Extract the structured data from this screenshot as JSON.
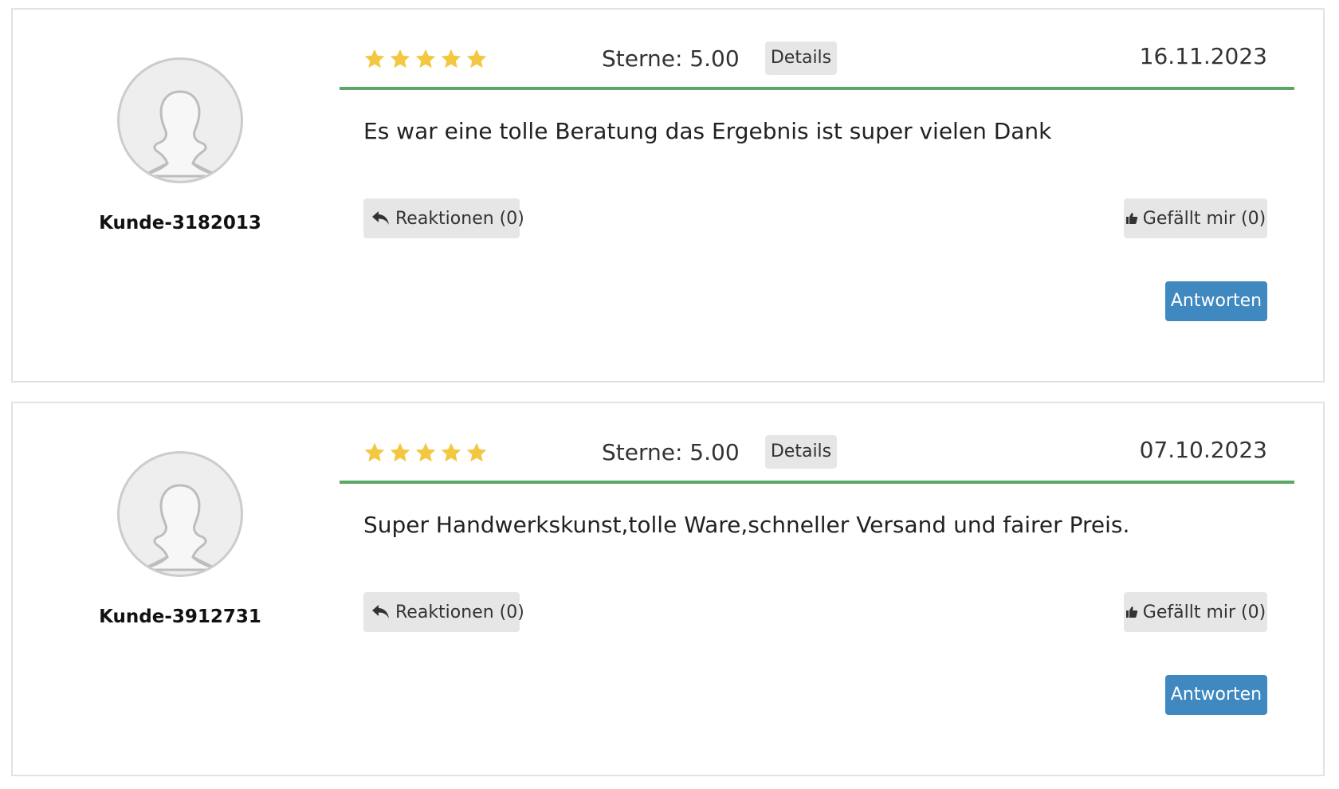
{
  "reviews": [
    {
      "username": "Kunde-3182013",
      "score_text": "Sterne: 5.00",
      "stars": 5,
      "details_label": "Details",
      "date": "16.11.2023",
      "text": "Es war eine tolle Beratung das Ergebnis ist super vielen Dank",
      "reactions_label": "Reaktionen (0)",
      "like_label": "Gefällt mir (0)",
      "reply_label": "Antworten"
    },
    {
      "username": "Kunde-3912731",
      "score_text": "Sterne: 5.00",
      "stars": 5,
      "details_label": "Details",
      "date": "07.10.2023",
      "text": "Super Handwerkskunst,tolle Ware,schneller Versand und fairer Preis.",
      "reactions_label": "Reaktionen (0)",
      "like_label": "Gefällt mir (0)",
      "reply_label": "Antworten"
    }
  ],
  "icons": {
    "avatar": "default-user-silhouette-icon",
    "star": "star-icon",
    "reactions": "reply-arrow-icon",
    "like": "thumbs-up-icon"
  },
  "colors": {
    "star": "#f3c73f",
    "divider": "#5aa864",
    "reply_button": "#3f88c0",
    "gray_button": "#e6e6e6",
    "card_border": "#e2e2e2"
  }
}
